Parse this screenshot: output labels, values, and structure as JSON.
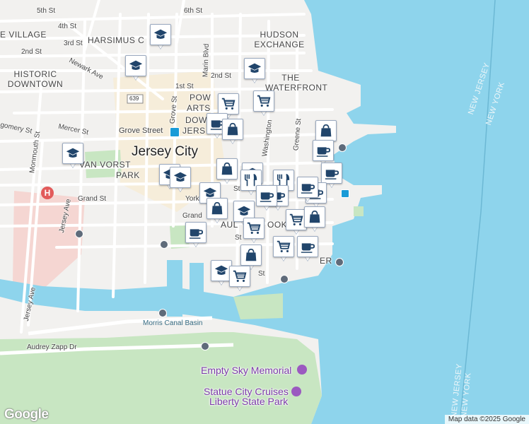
{
  "map": {
    "streets": [
      {
        "text": "5th St"
      },
      {
        "text": "6th St"
      },
      {
        "text": "4th St"
      },
      {
        "text": "3rd St"
      },
      {
        "text": "2nd St"
      },
      {
        "text": "Newark Ave"
      },
      {
        "text": "Marin Blvd"
      },
      {
        "text": "2nd St"
      },
      {
        "text": "1st St"
      },
      {
        "text": "Mercer St"
      },
      {
        "text": "Grove St"
      },
      {
        "text": "gomery St"
      },
      {
        "text": "Monmouth St"
      },
      {
        "text": "Grand St"
      },
      {
        "text": "Grand"
      },
      {
        "text": "Jersey Ave"
      },
      {
        "text": "Jersey Ave"
      },
      {
        "text": "Audrey Zapp Dr"
      },
      {
        "text": "Greene St"
      },
      {
        "text": "Washington"
      },
      {
        "text": "St"
      },
      {
        "text": "York"
      },
      {
        "text": "St"
      },
      {
        "text": "St"
      }
    ],
    "neighborhoods": [
      {
        "text": "E VILLAGE"
      },
      {
        "text": "HARSIMUS C"
      },
      {
        "text": "HUDSON EXCHANGE"
      },
      {
        "text": "HISTORIC DOWNTOWN"
      },
      {
        "text": "THE WATERFRONT"
      },
      {
        "text": "POW"
      },
      {
        "text": "ARTS"
      },
      {
        "text": "DOW"
      },
      {
        "text": "JERS"
      },
      {
        "text": "VAN VORST"
      },
      {
        "text": "PARK"
      },
      {
        "text": "AUL"
      },
      {
        "text": "OOK"
      },
      {
        "text": "ER"
      }
    ],
    "city_label": "Jersey City",
    "station_label": "Grove Street",
    "route_shield": "639",
    "water_labels": [
      {
        "text": "Morris Canal Basin"
      }
    ],
    "state_labels": [
      {
        "text": "NEW JERSEY"
      },
      {
        "text": "NEW YORK"
      },
      {
        "text": "NEW JERSEY"
      },
      {
        "text": "NEW YORK"
      }
    ],
    "pois": [
      {
        "text": "Empty Sky Memorial"
      },
      {
        "text": "Statue City Cruises"
      },
      {
        "text": "Liberty State Park"
      }
    ],
    "hospital_symbol": "H",
    "logo": "Google",
    "attribution": "Map data ©2025 Google",
    "colors": {
      "water": "#8ed4ec",
      "park": "#c8e6c2",
      "land": "#f2f1ef",
      "marker_icon": "#21456b",
      "hospital": "#e25a5a",
      "poi": "#9b59c0",
      "transit": "#1a9bd7"
    },
    "markers": [
      {
        "icon": "school-icon"
      },
      {
        "icon": "school-icon"
      },
      {
        "icon": "school-icon"
      },
      {
        "icon": "cart-icon"
      },
      {
        "icon": "cart-icon"
      },
      {
        "icon": "coffee-icon"
      },
      {
        "icon": "bag-icon"
      },
      {
        "icon": "bag-icon"
      },
      {
        "icon": "coffee-icon"
      },
      {
        "icon": "school-icon"
      },
      {
        "icon": "bag-icon"
      },
      {
        "icon": "coffee-icon"
      },
      {
        "icon": "school-icon"
      },
      {
        "icon": "school-icon"
      },
      {
        "icon": "school-icon"
      },
      {
        "icon": "school-icon"
      },
      {
        "icon": "restaurant-icon"
      },
      {
        "icon": "restaurant-icon"
      },
      {
        "icon": "coffee-icon"
      },
      {
        "icon": "coffee-icon"
      },
      {
        "icon": "coffee-icon"
      },
      {
        "icon": "coffee-icon"
      },
      {
        "icon": "bag-icon"
      },
      {
        "icon": "school-icon"
      },
      {
        "icon": "cart-icon"
      },
      {
        "icon": "cart-icon"
      },
      {
        "icon": "bag-icon"
      },
      {
        "icon": "coffee-icon"
      },
      {
        "icon": "cart-icon"
      },
      {
        "icon": "coffee-icon"
      },
      {
        "icon": "bag-icon"
      },
      {
        "icon": "school-icon"
      },
      {
        "icon": "cart-icon"
      }
    ]
  }
}
